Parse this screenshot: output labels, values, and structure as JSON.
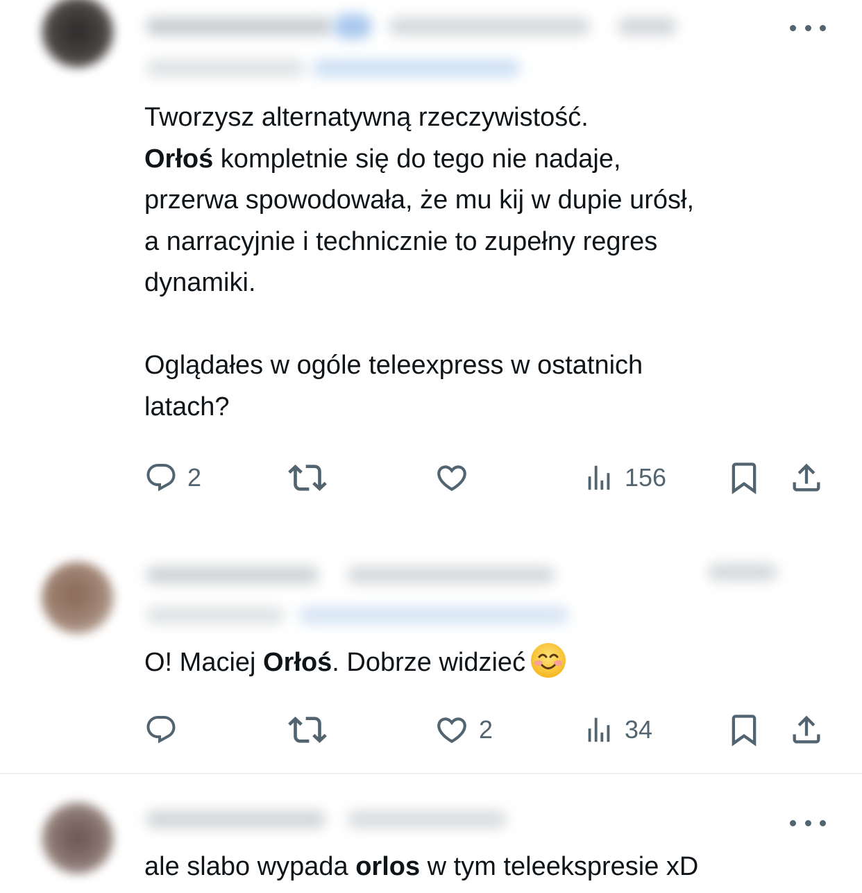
{
  "tweets": [
    {
      "paragraphs": [
        [
          {
            "t": "Tworzysz alternatywną rzeczywistość."
          }
        ],
        [
          {
            "t": "Orłoś",
            "b": true
          },
          {
            "t": " kompletnie się do tego nie nadaje,"
          }
        ],
        [
          {
            "t": "przerwa spowodowała, że mu kij w dupie urósł,"
          }
        ],
        [
          {
            "t": "a narracyjnie i technicznie to zupełny regres"
          }
        ],
        [
          {
            "t": "dynamiki."
          }
        ],
        [],
        [
          {
            "t": "Oglądałes w ogóle teleexpress w ostatnich"
          }
        ],
        [
          {
            "t": "latach?"
          }
        ]
      ],
      "replies": "2",
      "reposts": "",
      "likes": "",
      "views": "156"
    },
    {
      "paragraphs": [
        [
          {
            "t": "O! Maciej "
          },
          {
            "t": "Orłoś",
            "b": true
          },
          {
            "t": ". Dobrze widzieć"
          }
        ]
      ],
      "emoji": "smiling-face-with-smiling-eyes",
      "replies": "",
      "reposts": "",
      "likes": "2",
      "views": "34"
    },
    {
      "paragraphs": [
        [
          {
            "t": "ale slabo wypada "
          },
          {
            "t": "orlos",
            "b": true
          },
          {
            "t": " w tym teleekspresie xD"
          }
        ]
      ]
    }
  ],
  "icons": {
    "reply": "reply-bubble-icon",
    "repost": "repost-arrows-icon",
    "like": "heart-icon",
    "views": "views-bar-chart-icon",
    "bookmark": "bookmark-icon",
    "share": "share-upload-icon",
    "more": "more-dots-icon"
  },
  "colors": {
    "text": "#0f1419",
    "muted": "#536471",
    "divider": "#eff3f4"
  }
}
